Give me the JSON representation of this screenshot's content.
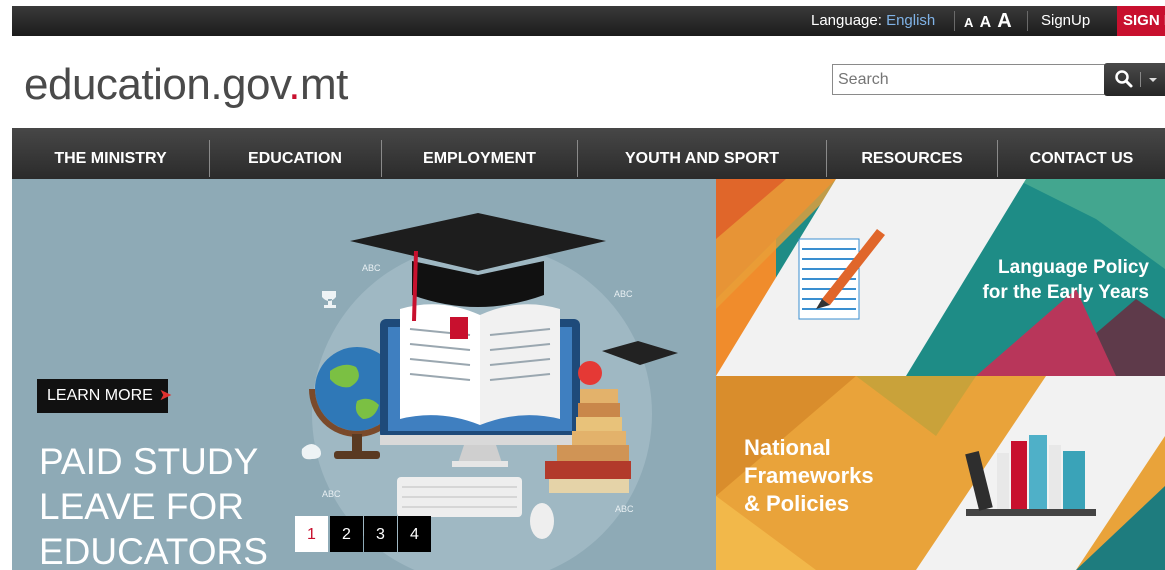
{
  "topbar": {
    "language_label": "Language:",
    "language_value": "English",
    "font_sizes": [
      "A",
      "A",
      "A"
    ],
    "signup": "SignUp",
    "signin": "SIGN IN"
  },
  "logo": {
    "part1": "education.gov",
    "dot": ".",
    "part2": "mt"
  },
  "search": {
    "placeholder": "Search"
  },
  "nav": {
    "items": [
      {
        "label": "THE MINISTRY"
      },
      {
        "label": "EDUCATION"
      },
      {
        "label": "EMPLOYMENT"
      },
      {
        "label": "YOUTH AND SPORT"
      },
      {
        "label": "RESOURCES"
      },
      {
        "label": "CONTACT US"
      }
    ]
  },
  "hero": {
    "learn_more": "LEARN MORE",
    "headline": [
      "PAID STUDY",
      "LEAVE FOR",
      "EDUCATORS"
    ],
    "slides": [
      "1",
      "2",
      "3",
      "4"
    ],
    "active_slide": "1",
    "decor_labels": [
      "ABC",
      "ABC",
      "ABC",
      "ABC",
      "ABC"
    ]
  },
  "tiles": {
    "tile1": {
      "line1": "Language Policy",
      "line2": "for the Early Years"
    },
    "tile2": {
      "line1": "National",
      "line2": "Frameworks",
      "line3": "& Policies"
    }
  },
  "colors": {
    "brand_red": "#c8102e",
    "nav_bg": "#333333",
    "hero_bg": "#8eaab6",
    "link_blue": "#7fb2e6"
  }
}
